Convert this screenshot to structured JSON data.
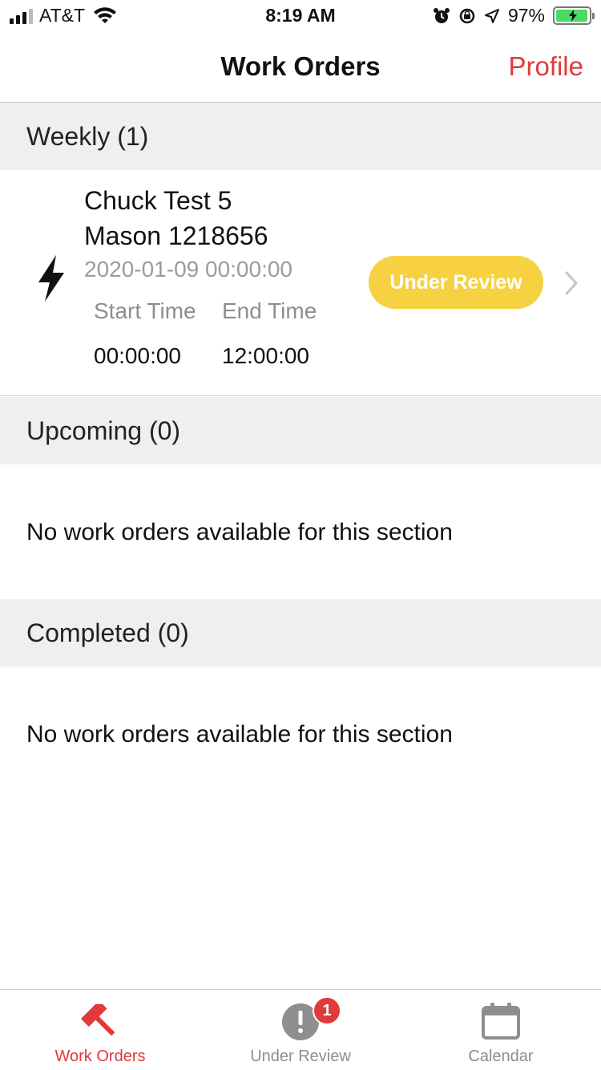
{
  "status_bar": {
    "carrier": "AT&T",
    "time": "8:19 AM",
    "battery_percent": "97%",
    "battery_level": 0.97
  },
  "nav": {
    "title": "Work Orders",
    "profile_label": "Profile"
  },
  "sections": [
    {
      "header": "Weekly (1)",
      "items": [
        {
          "icon": "lightning-bolt-icon",
          "line1": "Chuck Test 5",
          "line2": "Mason 1218656",
          "date": "2020-01-09 00:00:00",
          "start_label": "Start Time",
          "end_label": "End Time",
          "start_value": "00:00:00",
          "end_value": "12:00:00",
          "status": "Under Review",
          "status_color": "#f6d141"
        }
      ]
    },
    {
      "header": "Upcoming (0)",
      "empty_message": "No work orders available for this section"
    },
    {
      "header": "Completed (0)",
      "empty_message": "No work orders available for this section"
    }
  ],
  "tabs": [
    {
      "label": "Work Orders",
      "icon": "hammer-icon",
      "active": true
    },
    {
      "label": "Under Review",
      "icon": "exclamation-icon",
      "badge": "1"
    },
    {
      "label": "Calendar",
      "icon": "calendar-icon"
    }
  ],
  "colors": {
    "accent": "#e03a3a",
    "section_bg": "#efefef",
    "pill": "#f6d141"
  }
}
